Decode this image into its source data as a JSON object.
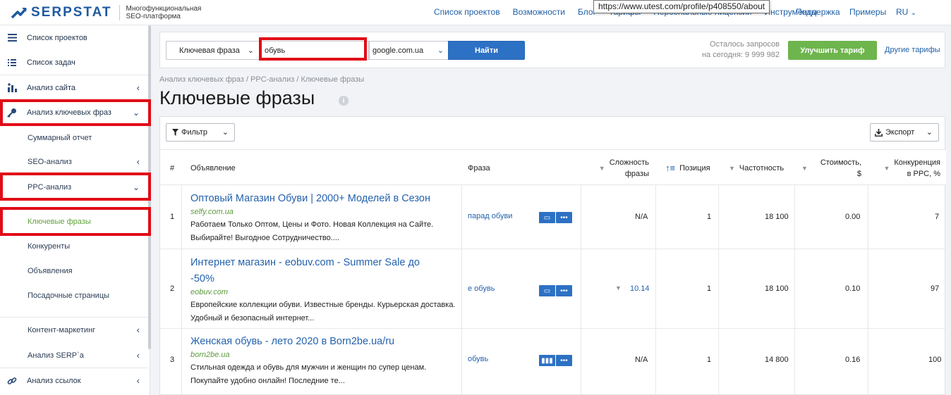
{
  "header": {
    "logo_text": "SERPSTAT",
    "logo_sub_line1": "Многофункциональная",
    "logo_sub_line2": "SEO-платформа",
    "nav": [
      "Список проектов",
      "Возможности",
      "Блог",
      "Тарифы",
      "Персональные лицензии",
      "Инструменты",
      "Поддержка",
      "Примеры",
      "RU"
    ],
    "tooltip": "https://www.utest.com/profile/p408550/about"
  },
  "sidebar": {
    "items": [
      {
        "label": "Список проектов",
        "icon": "hamburger-icon"
      },
      {
        "label": "Список задач",
        "icon": "list-icon"
      },
      {
        "label": "Анализ сайта",
        "icon": "chart-icon"
      },
      {
        "label": "Анализ ключевых фраз",
        "icon": "key-icon"
      },
      {
        "label": "Суммарный отчет"
      },
      {
        "label": "SEO-анализ"
      },
      {
        "label": "PPC-анализ"
      },
      {
        "label": "Ключевые фразы"
      },
      {
        "label": "Конкуренты"
      },
      {
        "label": "Объявления"
      },
      {
        "label": "Посадочные страницы"
      },
      {
        "label": "Контент-маркетинг"
      },
      {
        "label": "Анализ SERP`а"
      },
      {
        "label": "Анализ ссылок",
        "icon": "link-icon"
      }
    ]
  },
  "search": {
    "type_label": "Ключевая фраза",
    "query_value": "обувь",
    "database": "google.com.ua",
    "submit_label": "Найти",
    "remaining_line1": "Осталось запросов",
    "remaining_line2": "на сегодня: 9 999 982",
    "upgrade_label": "Улучшить тариф",
    "other_plans_label": "Другие тарифы"
  },
  "page": {
    "breadcrumb": "Анализ ключевых фраз / PPC-анализ / Ключевые фразы",
    "title": "Ключевые фразы",
    "filter_label": "Фильтр",
    "export_label": "Экспорт"
  },
  "table": {
    "columns": {
      "num": "#",
      "ad": "Объявление",
      "phrase": "Фраза",
      "difficulty_line1": "Сложность",
      "difficulty_line2": "фразы",
      "position": "Позиция",
      "frequency": "Частотность",
      "cost_line1": "Стоимость,",
      "cost_line2": "$",
      "competition_line1": "Конкуренция",
      "competition_line2": "в PPC, %"
    },
    "rows": [
      {
        "num": "1",
        "title": "Оптовый Магазин Обуви | 2000+ Моделей в Сезон",
        "url": "selfy.com.ua",
        "text": "Работаем Только Оптом, Цены и Фото. Новая Коллекция на Сайте. Выбирайте! Выгодное Сотрудничество....",
        "phrase": "парад обуви",
        "difficulty": "N/A",
        "position": "1",
        "frequency": "18 100",
        "cost": "0.00",
        "competition": "7"
      },
      {
        "num": "2",
        "title": "Интернет магазин - eobuv.com - Summer Sale до -50%",
        "url": "eobuv.com",
        "text": "Европейские коллекции обуви. Известные бренды. Курьерская доставка. Удобный и безопасный интернет...",
        "phrase": "е обувь",
        "difficulty": "10.14",
        "position": "1",
        "frequency": "18 100",
        "cost": "0.10",
        "competition": "97"
      },
      {
        "num": "3",
        "title": "Женская обувь - лето 2020 в Born2be.ua/ru",
        "url": "born2be.ua",
        "text": "Стильная одежда и обувь для мужчин и женщин по супер ценам. Покупайте удобно онлайн! Последние те...",
        "phrase": "обувь",
        "difficulty": "N/A",
        "position": "1",
        "frequency": "14 800",
        "cost": "0.16",
        "competition": "100"
      }
    ]
  },
  "colors": {
    "brand_blue": "#1f5aa0",
    "link_blue": "#2462ad",
    "button_blue": "#2d71c4",
    "upgrade_green": "#6db54c",
    "highlight_red": "#e10b17",
    "url_green": "#5d9a3e"
  }
}
